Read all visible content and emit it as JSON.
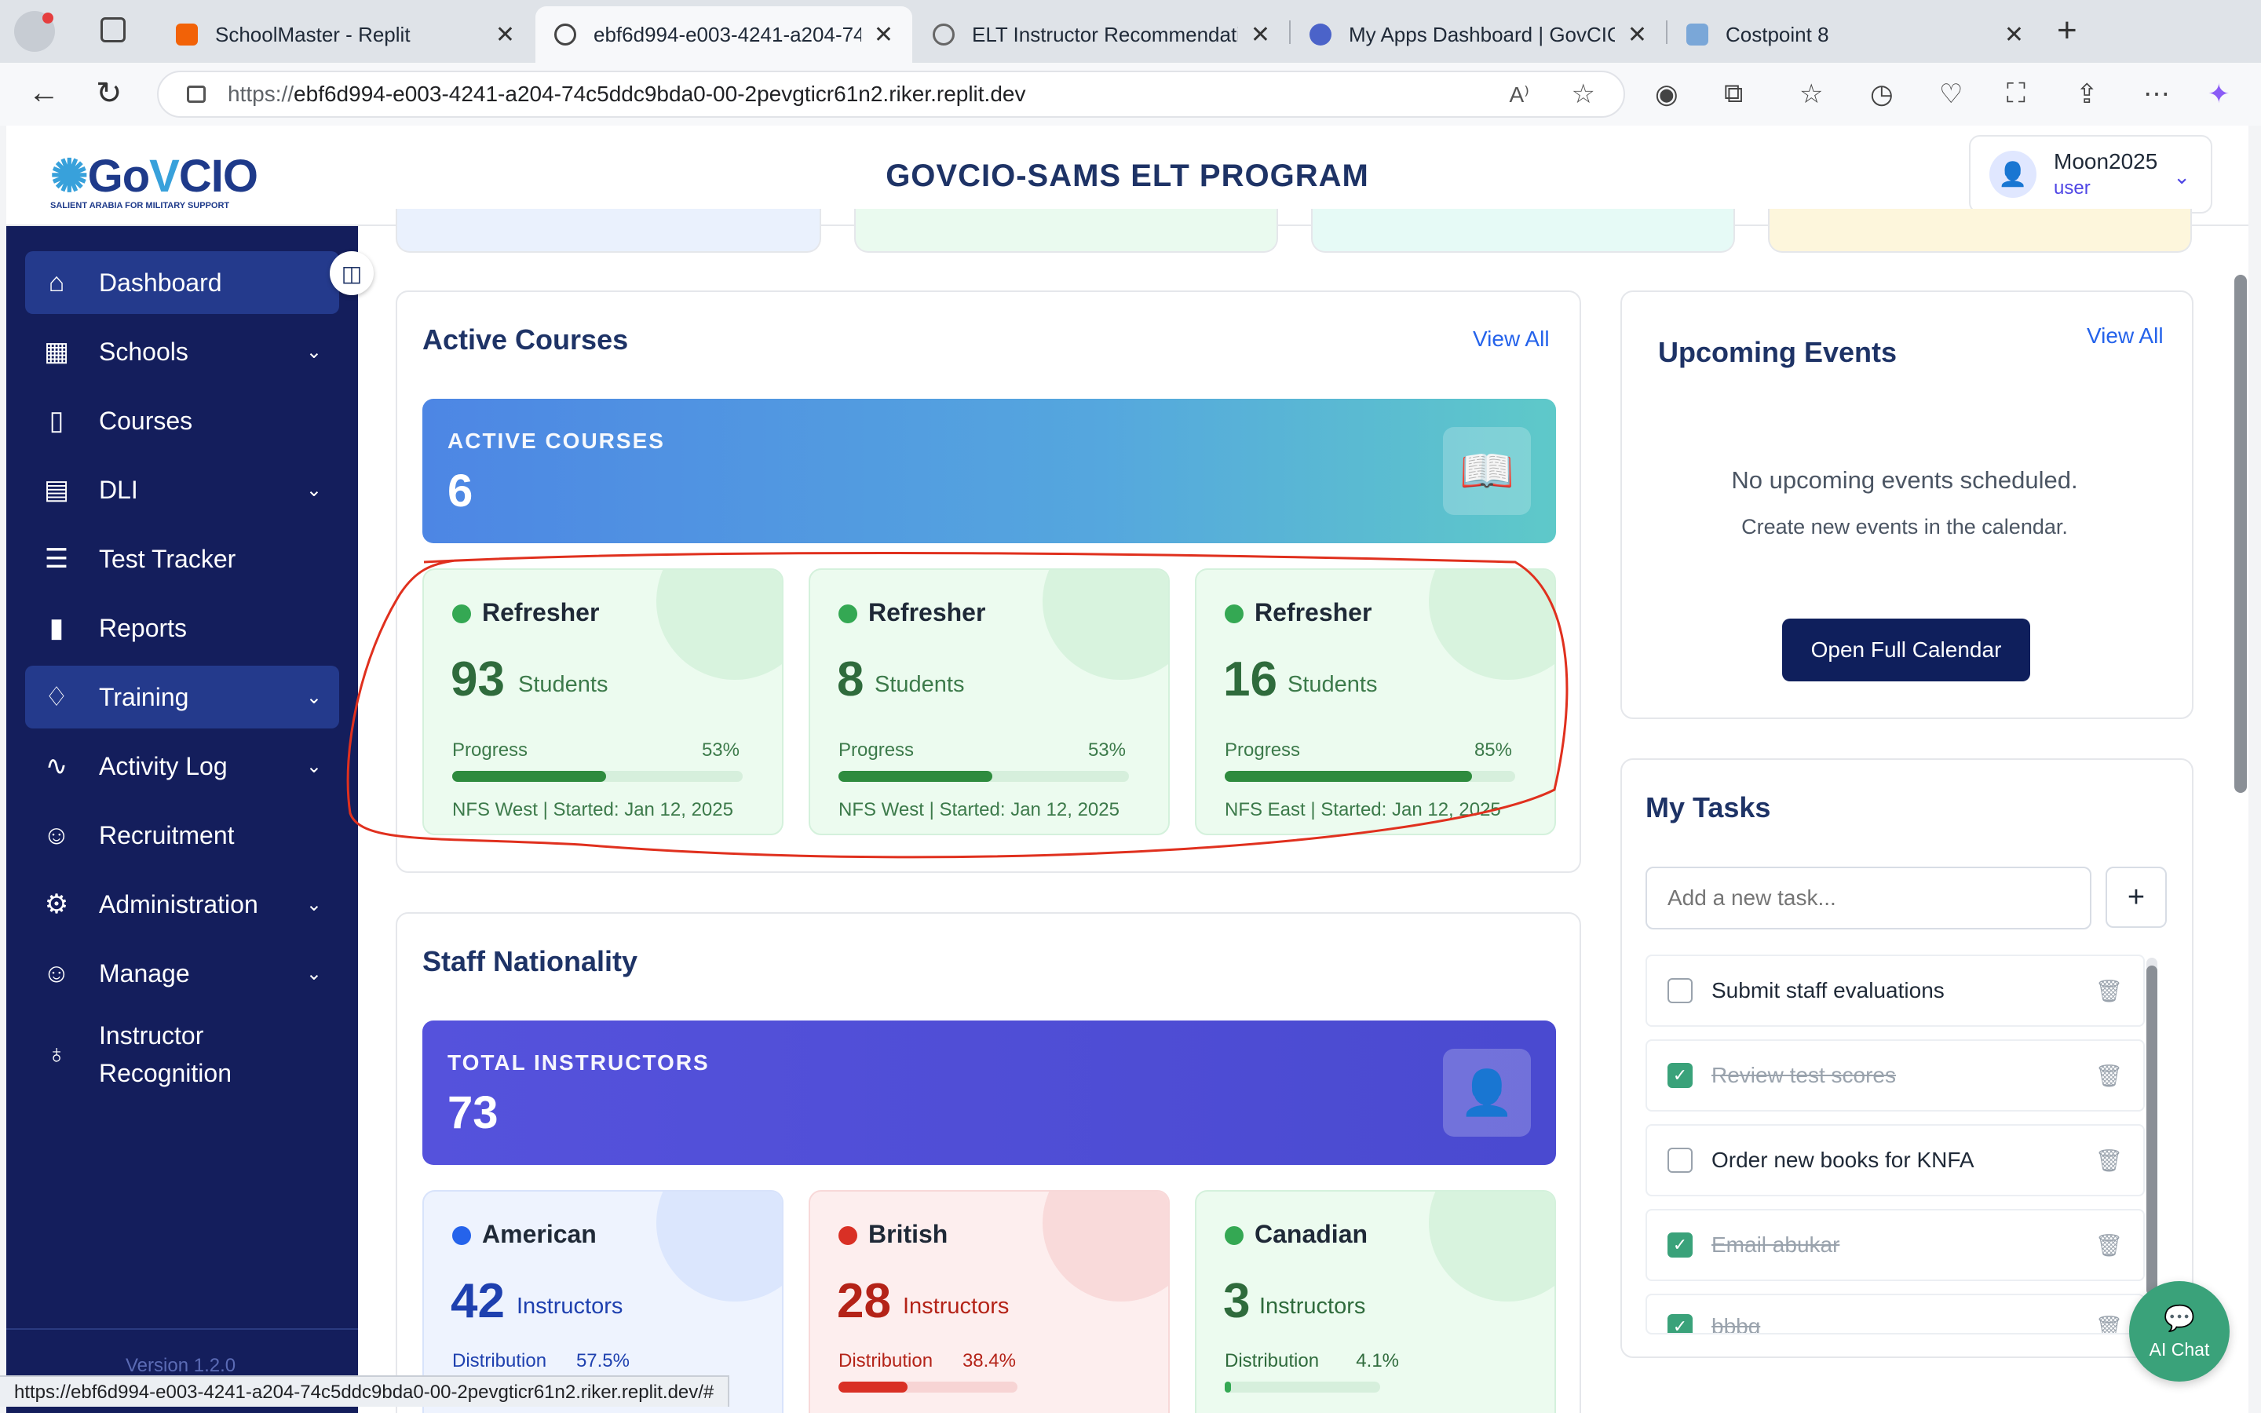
{
  "browser": {
    "tabs": [
      {
        "label": "SchoolMaster - Replit",
        "active": false
      },
      {
        "label": "ebf6d994-e003-4241-a204-74",
        "active": true
      },
      {
        "label": "ELT Instructor Recommendation",
        "active": false
      },
      {
        "label": "My Apps Dashboard | GovCIO",
        "active": false
      },
      {
        "label": "Costpoint 8",
        "active": false
      }
    ],
    "url_protocol": "https://",
    "url_rest": "ebf6d994-e003-4241-a204-74c5ddc9bda0-00-2pevgticr61n2.riker.replit.dev",
    "status_url": "https://ebf6d994-e003-4241-a204-74c5ddc9bda0-00-2pevgticr61n2.riker.replit.dev/#"
  },
  "header": {
    "logo_text_a": "Go",
    "logo_text_b": "V",
    "logo_text_c": "CIO",
    "logo_tagline": "SALIENT ARABIA FOR MILITARY SUPPORT",
    "title": "GOVCIO-SAMS ELT PROGRAM",
    "user_name": "Moon2025",
    "user_role": "user"
  },
  "sidebar": {
    "items": [
      {
        "label": "Dashboard",
        "icon": "home-icon",
        "active": true
      },
      {
        "label": "Schools",
        "icon": "building-icon"
      },
      {
        "label": "Courses",
        "icon": "book-icon"
      },
      {
        "label": "DLI",
        "icon": "clipboard-icon"
      },
      {
        "label": "Test Tracker",
        "icon": "checklist-icon"
      },
      {
        "label": "Reports",
        "icon": "bar-chart-icon"
      },
      {
        "label": "Training",
        "icon": "lightbulb-icon",
        "active": true
      },
      {
        "label": "Activity Log",
        "icon": "activity-icon"
      },
      {
        "label": "Recruitment",
        "icon": "users-icon"
      },
      {
        "label": "Administration",
        "icon": "gear-icon"
      },
      {
        "label": "Manage",
        "icon": "users-icon"
      },
      {
        "label": "Instructor",
        "label2": "Recognition",
        "icon": "award-icon"
      }
    ],
    "version": "Version 1.2.0"
  },
  "active_courses": {
    "title": "Active Courses",
    "view_all": "View All",
    "banner_label": "ACTIVE COURSES",
    "banner_value": "6",
    "cards": [
      {
        "name": "Refresher",
        "count": "93",
        "unit": "Students",
        "progress_label": "Progress",
        "progress": "53%",
        "progress_value": 53,
        "footer": "NFS West | Started: Jan 12, 2025"
      },
      {
        "name": "Refresher",
        "count": "8",
        "unit": "Students",
        "progress_label": "Progress",
        "progress": "53%",
        "progress_value": 53,
        "footer": "NFS West | Started: Jan 12, 2025"
      },
      {
        "name": "Refresher",
        "count": "16",
        "unit": "Students",
        "progress_label": "Progress",
        "progress": "85%",
        "progress_value": 85,
        "footer": "NFS East | Started: Jan 12, 2025"
      }
    ]
  },
  "staff_nationality": {
    "title": "Staff Nationality",
    "banner_label": "TOTAL INSTRUCTORS",
    "banner_value": "73",
    "cards": [
      {
        "name": "American",
        "count": "42",
        "unit": "Instructors",
        "dist_label": "Distribution",
        "dist": "57.5%",
        "dist_value": 57.5
      },
      {
        "name": "British",
        "count": "28",
        "unit": "Instructors",
        "dist_label": "Distribution",
        "dist": "38.4%",
        "dist_value": 38.4
      },
      {
        "name": "Canadian",
        "count": "3",
        "unit": "Instructors",
        "dist_label": "Distribution",
        "dist": "4.1%",
        "dist_value": 4.1
      }
    ]
  },
  "events": {
    "title": "Upcoming Events",
    "view_all": "View All",
    "empty_primary": "No upcoming events scheduled.",
    "empty_secondary": "Create new events in the calendar.",
    "button": "Open Full Calendar"
  },
  "tasks": {
    "title": "My Tasks",
    "placeholder": "Add a new task...",
    "add_label": "+",
    "items": [
      {
        "text": "Submit staff evaluations",
        "done": false
      },
      {
        "text": "Review test scores",
        "done": true
      },
      {
        "text": "Order new books for KNFA",
        "done": false
      },
      {
        "text": "Email abukar",
        "done": true
      },
      {
        "text": "bbbg",
        "done": true
      }
    ]
  },
  "ai_chat": {
    "label": "AI Chat"
  },
  "colors": {
    "sidebar": "#141e5c",
    "accent": "#2563eb",
    "success": "#34a853",
    "danger": "#d93025"
  }
}
